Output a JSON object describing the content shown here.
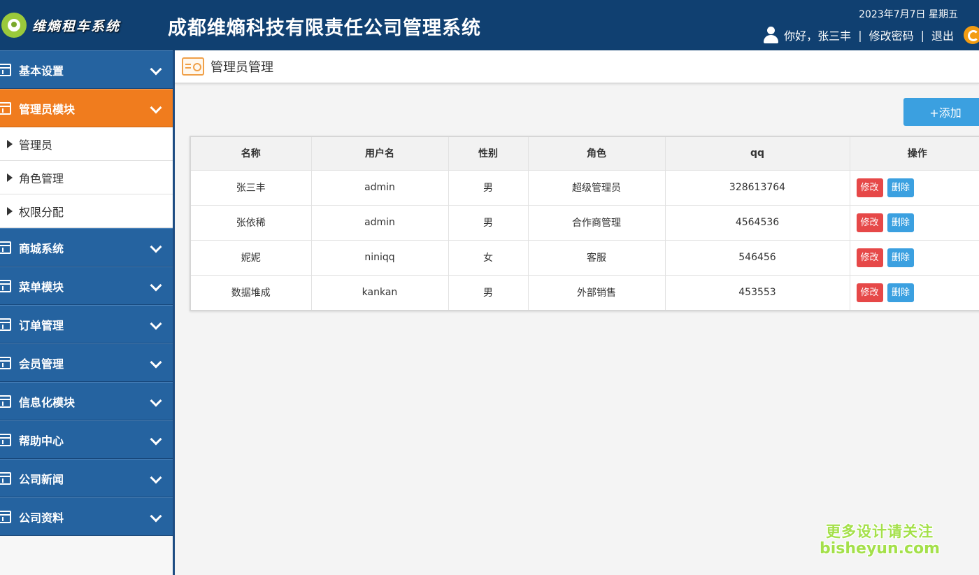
{
  "header": {
    "logo_text": "维熵租车系统",
    "title": "成都维熵科技有限责任公司管理系统",
    "date": "2023年7月7日 星期五",
    "greeting": "你好，张三丰",
    "change_password": "修改密码",
    "logout": "退出",
    "separator": "|"
  },
  "sidebar": {
    "groups": [
      {
        "label": "基本设置",
        "active": false
      },
      {
        "label": "管理员模块",
        "active": true
      },
      {
        "label": "商城系统",
        "active": false
      },
      {
        "label": "菜单模块",
        "active": false
      },
      {
        "label": "订单管理",
        "active": false
      },
      {
        "label": "会员管理",
        "active": false
      },
      {
        "label": "信息化模块",
        "active": false
      },
      {
        "label": "帮助中心",
        "active": false
      },
      {
        "label": "公司新闻",
        "active": false
      },
      {
        "label": "公司资料",
        "active": false
      }
    ],
    "sub_items": [
      "管理员",
      "角色管理",
      "权限分配"
    ]
  },
  "main": {
    "page_title": "管理员管理",
    "add_button": "+添加",
    "table": {
      "headers": [
        "名称",
        "用户名",
        "性别",
        "角色",
        "qq",
        "操作"
      ],
      "rows": [
        {
          "name": "张三丰",
          "username": "admin",
          "gender": "男",
          "role": "超级管理员",
          "qq": "328613764"
        },
        {
          "name": "张依稀",
          "username": "admin",
          "gender": "男",
          "role": "合作商管理",
          "qq": "4564536"
        },
        {
          "name": "妮妮",
          "username": "niniqq",
          "gender": "女",
          "role": "客服",
          "qq": "546456"
        },
        {
          "name": "数据堆成",
          "username": "kankan",
          "gender": "男",
          "role": "外部销售",
          "qq": "453553"
        }
      ],
      "edit_label": "修改",
      "delete_label": "删除"
    }
  },
  "watermark": {
    "line1": "更多设计请关注",
    "line2": "bisheyun.com"
  },
  "colors": {
    "header_bg": "#104071",
    "sidebar_group_bg": "#2563a0",
    "sidebar_active_bg": "#f07c1e",
    "add_button_bg": "#3ba0e0",
    "edit_button_bg": "#e64848",
    "delete_button_bg": "#3ba0e0"
  }
}
